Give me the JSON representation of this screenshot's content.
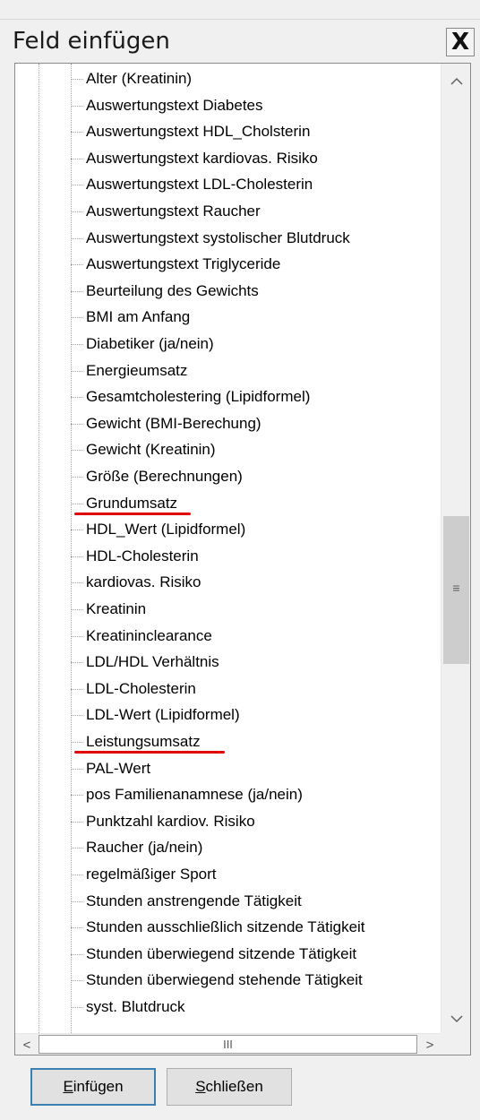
{
  "dialog": {
    "title": "Feld einfügen",
    "close_symbol": "X"
  },
  "tree": {
    "items": [
      "Alter (Kreatinin)",
      "Auswertungstext Diabetes",
      "Auswertungstext HDL_Cholsterin",
      "Auswertungstext kardiovas. Risiko",
      "Auswertungstext LDL-Cholesterin",
      "Auswertungstext Raucher",
      "Auswertungstext systolischer Blutdruck",
      "Auswertungstext Triglyceride",
      "Beurteilung des Gewichts",
      "BMI am Anfang",
      "Diabetiker (ja/nein)",
      "Energieumsatz",
      "Gesamtcholestering (Lipidformel)",
      "Gewicht (BMI-Berechung)",
      "Gewicht (Kreatinin)",
      "Größe (Berechnungen)",
      "Grundumsatz",
      "HDL_Wert (Lipidformel)",
      "HDL-Cholesterin",
      "kardiovas. Risiko",
      "Kreatinin",
      "Kreatininclearance",
      "LDL/HDL Verhältnis",
      "LDL-Cholesterin",
      "LDL-Wert (Lipidformel)",
      "Leistungsumsatz",
      "PAL-Wert",
      "pos Familienanamnese (ja/nein)",
      "Punktzahl kardiov. Risiko",
      "Raucher (ja/nein)",
      "regelmäßiger Sport",
      "Stunden anstrengende Tätigkeit",
      "Stunden ausschließlich sitzende Tätigkeit",
      "Stunden überwiegend sitzende Tätigkeit",
      "Stunden überwiegend stehende Tätigkeit",
      "syst. Blutdruck"
    ],
    "highlighted": [
      "Grundumsatz",
      "Leistungsumsatz"
    ],
    "highlight_color": "#e00000"
  },
  "scrollbar": {
    "up_arrow": "^",
    "down_arrow": "v",
    "grip": "≡",
    "left_arrow": "<",
    "right_arrow": ">",
    "h_grip": "III"
  },
  "buttons": {
    "insert_label": "Einfügen",
    "close_label": "Schließen"
  }
}
